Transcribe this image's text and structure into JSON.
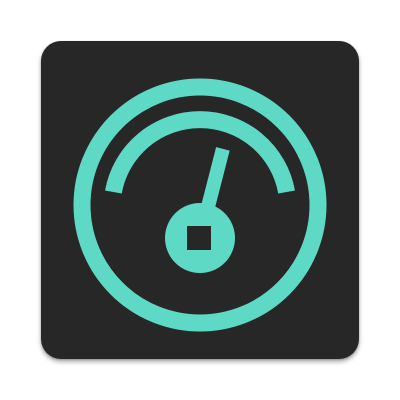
{
  "app_icon": {
    "icon": "speedometer-icon",
    "tile_color": "#272727",
    "accent_color": "#5ED9C6",
    "gauge_level": 0.62
  }
}
